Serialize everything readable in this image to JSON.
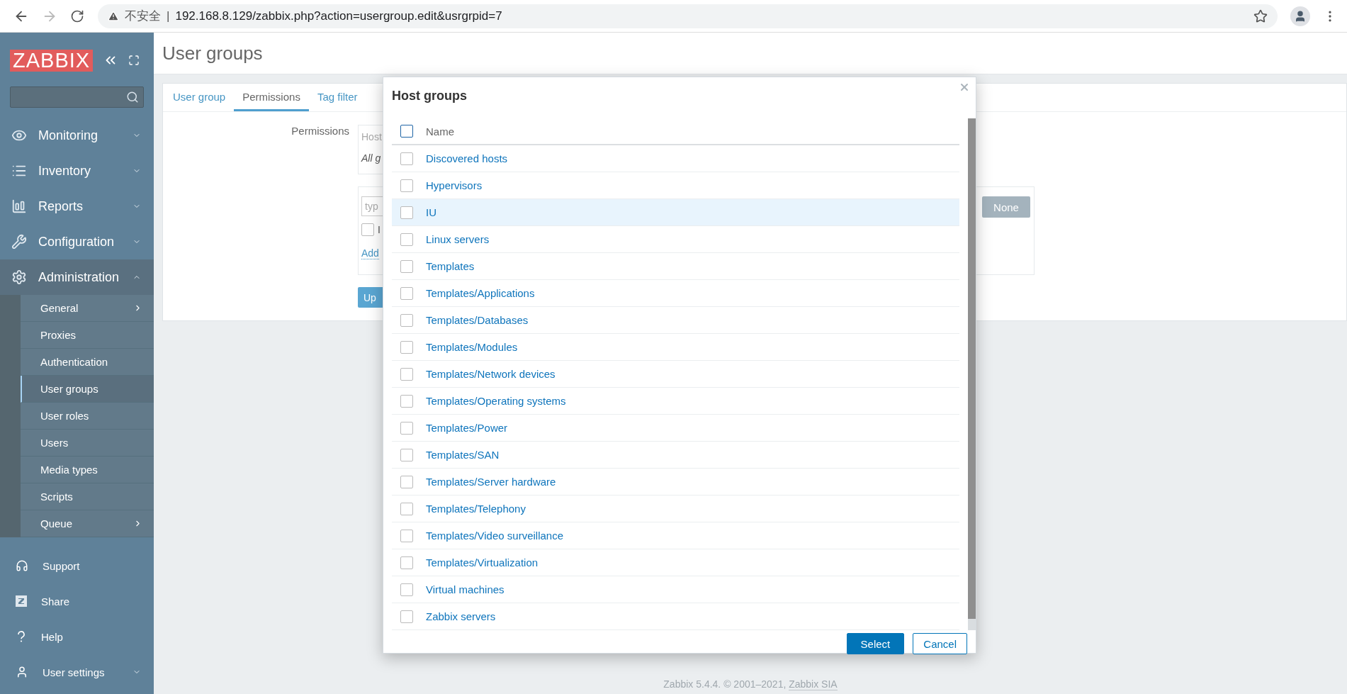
{
  "browser": {
    "security_label": "不安全",
    "separator": "|",
    "url": "192.168.8.129/zabbix.php?action=usergroup.edit&usrgrpid=7"
  },
  "sidebar": {
    "logo": "ZABBIX",
    "menu": [
      {
        "label": "Monitoring",
        "expanded": false
      },
      {
        "label": "Inventory",
        "expanded": false
      },
      {
        "label": "Reports",
        "expanded": false
      },
      {
        "label": "Configuration",
        "expanded": false
      },
      {
        "label": "Administration",
        "expanded": true,
        "children": [
          {
            "label": "General",
            "selected": false,
            "has_submenu": true
          },
          {
            "label": "Proxies",
            "selected": false,
            "has_submenu": false
          },
          {
            "label": "Authentication",
            "selected": false,
            "has_submenu": false
          },
          {
            "label": "User groups",
            "selected": true,
            "has_submenu": false
          },
          {
            "label": "User roles",
            "selected": false,
            "has_submenu": false
          },
          {
            "label": "Users",
            "selected": false,
            "has_submenu": false
          },
          {
            "label": "Media types",
            "selected": false,
            "has_submenu": false
          },
          {
            "label": "Scripts",
            "selected": false,
            "has_submenu": false
          },
          {
            "label": "Queue",
            "selected": false,
            "has_submenu": true
          }
        ]
      }
    ],
    "bottom": [
      {
        "label": "Support",
        "expandable": false
      },
      {
        "label": "Share",
        "expandable": false
      },
      {
        "label": "Help",
        "expandable": false
      },
      {
        "label": "User settings",
        "expandable": true
      }
    ]
  },
  "page": {
    "title": "User groups",
    "tabs": [
      {
        "label": "User group",
        "selected": false
      },
      {
        "label": "Permissions",
        "selected": true
      },
      {
        "label": "Tag filter",
        "selected": false
      }
    ],
    "form": {
      "label": "Permissions",
      "host_column": "Host",
      "all_groups": "All g",
      "input_placeholder": "typ",
      "checkbox_checked": false,
      "checkbox_label": "I",
      "add_link": "Add",
      "none_button": "None",
      "update_button": "Up"
    },
    "footer": {
      "text": "Zabbix 5.4.4. © 2001–2021, ",
      "link": "Zabbix SIA"
    }
  },
  "dialog": {
    "title": "Host groups",
    "column": "Name",
    "header_checked": false,
    "rows": [
      {
        "name": "Discovered hosts",
        "checked": false,
        "hovered": false
      },
      {
        "name": "Hypervisors",
        "checked": false,
        "hovered": false
      },
      {
        "name": "IU",
        "checked": false,
        "hovered": true
      },
      {
        "name": "Linux servers",
        "checked": false,
        "hovered": false
      },
      {
        "name": "Templates",
        "checked": false,
        "hovered": false
      },
      {
        "name": "Templates/Applications",
        "checked": false,
        "hovered": false
      },
      {
        "name": "Templates/Databases",
        "checked": false,
        "hovered": false
      },
      {
        "name": "Templates/Modules",
        "checked": false,
        "hovered": false
      },
      {
        "name": "Templates/Network devices",
        "checked": false,
        "hovered": false
      },
      {
        "name": "Templates/Operating systems",
        "checked": false,
        "hovered": false
      },
      {
        "name": "Templates/Power",
        "checked": false,
        "hovered": false
      },
      {
        "name": "Templates/SAN",
        "checked": false,
        "hovered": false
      },
      {
        "name": "Templates/Server hardware",
        "checked": false,
        "hovered": false
      },
      {
        "name": "Templates/Telephony",
        "checked": false,
        "hovered": false
      },
      {
        "name": "Templates/Video surveillance",
        "checked": false,
        "hovered": false
      },
      {
        "name": "Templates/Virtualization",
        "checked": false,
        "hovered": false
      },
      {
        "name": "Virtual machines",
        "checked": false,
        "hovered": false
      },
      {
        "name": "Zabbix servers",
        "checked": false,
        "hovered": false
      }
    ],
    "buttons": [
      {
        "label": "Select",
        "kind": "primary"
      },
      {
        "label": "Cancel",
        "kind": "secondary"
      }
    ]
  }
}
